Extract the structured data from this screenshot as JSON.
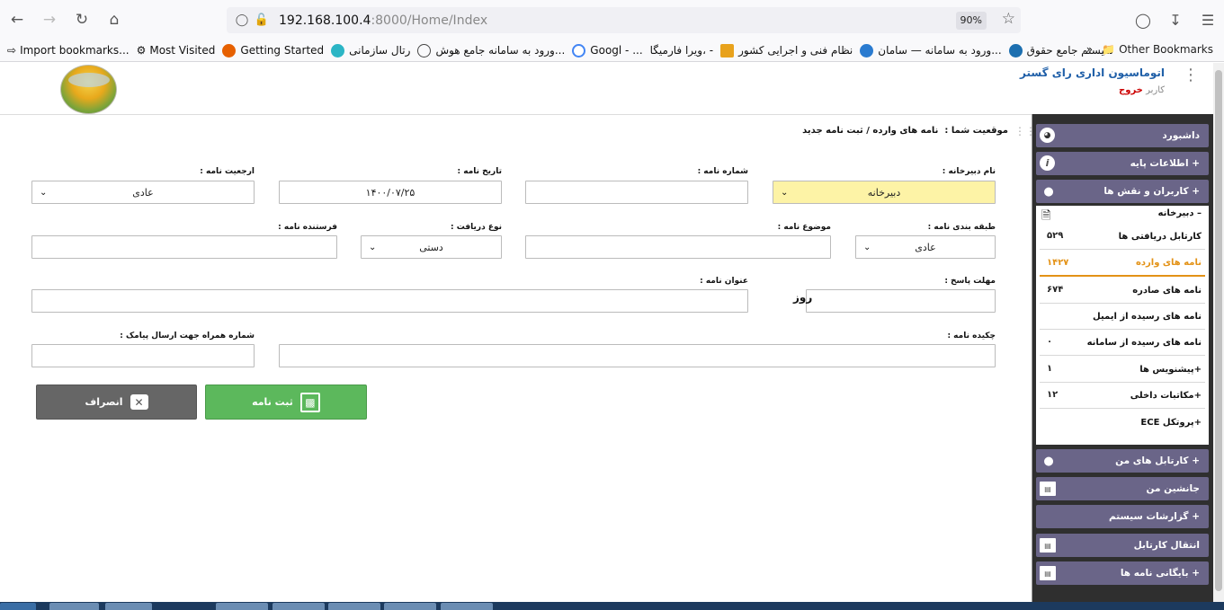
{
  "browser": {
    "url_host": "192.168.100.4",
    "url_rest": ":8000/Home/Index",
    "zoom": "90%",
    "bookmarks": [
      "Import bookmarks...",
      "Most Visited",
      "Getting Started",
      "رتال سازمانی",
      "ورود به سامانه جامع هوش...",
      "Googl - ...",
      "ویرا فارمیگا، -",
      "نظام فنی و اجرایی کشور",
      "ورود به سامانه — سامان...",
      "سیستم جامع حقوق"
    ],
    "other_bookmarks": "Other Bookmarks"
  },
  "header": {
    "app_title": "اتوماسیون اداری رای گستر",
    "user_label": "کاربر",
    "logout": "خروج"
  },
  "breadcrumb": {
    "prefix": "موقعیت شما :",
    "path": "نامه های وارده / ثبت نامه جدید"
  },
  "form": {
    "secretariat_label": "نام دبیرخانه :",
    "secretariat_value": "دبیرخانه",
    "letter_number_label": "شماره نامه :",
    "letter_date_label": "تاریخ نامه :",
    "letter_date_value": "۱۴۰۰/۰۷/۲۵",
    "priority_label": "ارجعیت نامه :",
    "priority_value": "عادی",
    "classification_label": "طبقه بندی نامه :",
    "classification_value": "عادی",
    "subject_label": "موضوع نامه :",
    "receive_type_label": "نوع دریافت :",
    "receive_type_value": "دستی",
    "sender_label": "فرستنده نامه :",
    "deadline_label": "مهلت پاسخ :",
    "deadline_suffix": "روز",
    "title_label": "عنوان نامه :",
    "abstract_label": "چکیده نامه :",
    "sms_label": "شماره همراه جهت ارسال پیامک :",
    "save_button": "ثبت نامه",
    "cancel_button": "انصراف"
  },
  "sidebar": {
    "dashboard": "داشبورد",
    "base_info": "+ اطلاعات پایه",
    "users_roles": "+ کاربران و نقش ها",
    "secretariat": "– دبیرخانه",
    "sub_items": [
      {
        "label": "کارتابل دریافتی ها",
        "count": "۵۲۹"
      },
      {
        "label": "نامه های وارده",
        "count": "۱۴۲۷"
      },
      {
        "label": "نامه های صادره",
        "count": "۶۷۴"
      },
      {
        "label": "نامه های رسیده از ایمیل",
        "count": ""
      },
      {
        "label": "نامه های رسیده از سامانه",
        "count": "۰"
      },
      {
        "label": "+پیشنویس ها",
        "count": "۱"
      },
      {
        "label": "+مکاتبات داخلی",
        "count": "۱۲"
      },
      {
        "label": "+پروتکل ECE",
        "count": ""
      }
    ],
    "my_cartables": "+ کارتابل های من",
    "my_deputy": "جانشین من",
    "system_reports": "+ گزارشات سیستم",
    "transfer_cartable": "انتقال کارتابل",
    "letters_archive": "+ بایگانی نامه ها"
  }
}
